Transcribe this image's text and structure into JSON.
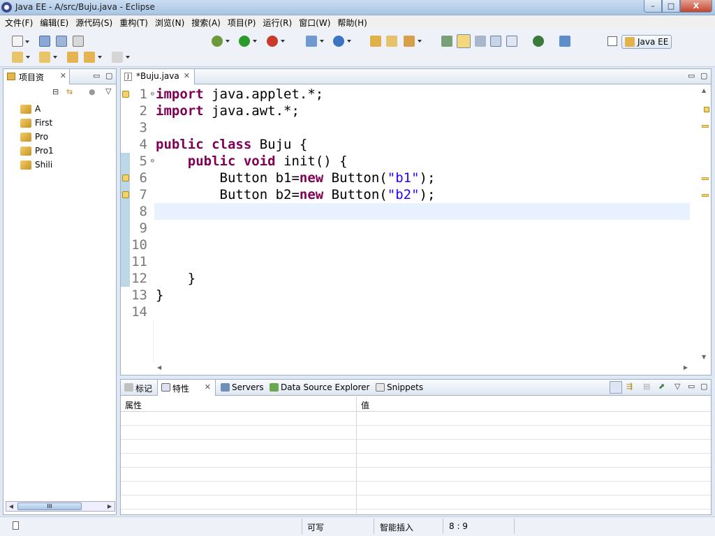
{
  "window": {
    "title": "Java EE  -  A/src/Buju.java  -  Eclipse",
    "buttons": {
      "minimize": "–",
      "maximize": "□",
      "close": "X"
    }
  },
  "menu": [
    "文件(F)",
    "编辑(E)",
    "源代码(S)",
    "重构(T)",
    "浏览(N)",
    "搜索(A)",
    "项目(P)",
    "运行(R)",
    "窗口(W)",
    "帮助(H)"
  ],
  "perspective": {
    "label": "Java EE"
  },
  "explorer": {
    "tab_label": "项目资",
    "projects": [
      "A",
      "First",
      "Pro",
      "Pro1",
      "Shili"
    ],
    "scroll_thumb": "III"
  },
  "editor": {
    "tab_label": "*Buju.java",
    "tab_icon": "J",
    "current_line": 8,
    "lines": [
      {
        "n": "1",
        "tokens": [
          {
            "k": "kw",
            "t": "import"
          },
          {
            "k": "",
            "t": " java.applet.*;"
          }
        ],
        "fold": "⊖",
        "warn": true
      },
      {
        "n": "2",
        "tokens": [
          {
            "k": "kw",
            "t": "import"
          },
          {
            "k": "",
            "t": " java.awt.*;"
          }
        ]
      },
      {
        "n": "3",
        "tokens": []
      },
      {
        "n": "4",
        "tokens": [
          {
            "k": "kw",
            "t": "public"
          },
          {
            "k": "",
            "t": " "
          },
          {
            "k": "kw",
            "t": "class"
          },
          {
            "k": "",
            "t": " Buju {"
          }
        ]
      },
      {
        "n": "5",
        "tokens": [
          {
            "k": "",
            "t": "    "
          },
          {
            "k": "kw",
            "t": "public"
          },
          {
            "k": "",
            "t": " "
          },
          {
            "k": "kw",
            "t": "void"
          },
          {
            "k": "",
            "t": " init() {"
          }
        ],
        "fold": "⊖"
      },
      {
        "n": "6",
        "tokens": [
          {
            "k": "",
            "t": "        Button b1="
          },
          {
            "k": "kw",
            "t": "new"
          },
          {
            "k": "",
            "t": " Button("
          },
          {
            "k": "str",
            "t": "\"b1\""
          },
          {
            "k": "",
            "t": ");"
          }
        ],
        "warn": true
      },
      {
        "n": "7",
        "tokens": [
          {
            "k": "",
            "t": "        Button b2="
          },
          {
            "k": "kw",
            "t": "new"
          },
          {
            "k": "",
            "t": " Button("
          },
          {
            "k": "str",
            "t": "\"b2\""
          },
          {
            "k": "",
            "t": ");"
          }
        ],
        "warn": true
      },
      {
        "n": "8",
        "tokens": []
      },
      {
        "n": "9",
        "tokens": []
      },
      {
        "n": "10",
        "tokens": []
      },
      {
        "n": "11",
        "tokens": []
      },
      {
        "n": "12",
        "tokens": [
          {
            "k": "",
            "t": "    }"
          }
        ]
      },
      {
        "n": "13",
        "tokens": [
          {
            "k": "",
            "t": "}"
          }
        ]
      },
      {
        "n": "14",
        "tokens": []
      }
    ]
  },
  "bottom": {
    "tabs": [
      {
        "label": "标记",
        "icon": "markers-icon"
      },
      {
        "label": "特性",
        "icon": "properties-icon",
        "active": true
      },
      {
        "label": "Servers",
        "icon": "servers-icon"
      },
      {
        "label": "Data Source Explorer",
        "icon": "data-source-icon"
      },
      {
        "label": "Snippets",
        "icon": "snippets-icon"
      }
    ],
    "columns": {
      "property": "属性",
      "value": "值"
    }
  },
  "status": {
    "writable": "可写",
    "insert_mode": "智能插入",
    "position": "8 : 9"
  },
  "colors": {
    "keyword": "#7f0055",
    "string": "#2a00ff",
    "current_line": "#e8f2fe",
    "line_number": "#787878"
  }
}
